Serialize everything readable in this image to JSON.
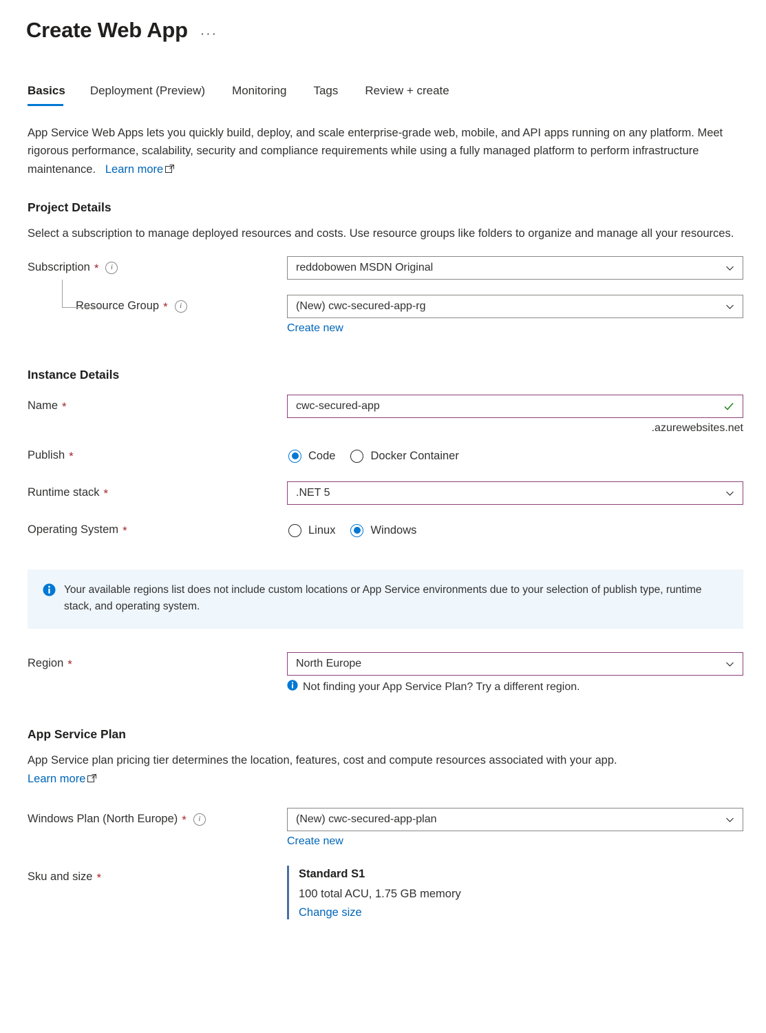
{
  "header": {
    "title": "Create Web App",
    "more_label": "···"
  },
  "tabs": [
    {
      "label": "Basics",
      "active": true
    },
    {
      "label": "Deployment (Preview)",
      "active": false
    },
    {
      "label": "Monitoring",
      "active": false
    },
    {
      "label": "Tags",
      "active": false
    },
    {
      "label": "Review + create",
      "active": false
    }
  ],
  "intro": {
    "text": "App Service Web Apps lets you quickly build, deploy, and scale enterprise-grade web, mobile, and API apps running on any platform. Meet rigorous performance, scalability, security and compliance requirements while using a fully managed platform to perform infrastructure maintenance.",
    "learn_more": "Learn more"
  },
  "project_details": {
    "heading": "Project Details",
    "description": "Select a subscription to manage deployed resources and costs. Use resource groups like folders to organize and manage all your resources.",
    "subscription": {
      "label": "Subscription",
      "required": "*",
      "value": "reddobowen MSDN Original"
    },
    "resource_group": {
      "label": "Resource Group",
      "required": "*",
      "value": "(New) cwc-secured-app-rg",
      "create_new": "Create new"
    }
  },
  "instance_details": {
    "heading": "Instance Details",
    "name": {
      "label": "Name",
      "required": "*",
      "value": "cwc-secured-app",
      "suffix": ".azurewebsites.net"
    },
    "publish": {
      "label": "Publish",
      "required": "*",
      "options": [
        {
          "label": "Code",
          "selected": true
        },
        {
          "label": "Docker Container",
          "selected": false
        }
      ]
    },
    "runtime_stack": {
      "label": "Runtime stack",
      "required": "*",
      "value": ".NET 5"
    },
    "operating_system": {
      "label": "Operating System",
      "required": "*",
      "options": [
        {
          "label": "Linux",
          "selected": false
        },
        {
          "label": "Windows",
          "selected": true
        }
      ]
    }
  },
  "banner": {
    "text": "Your available regions list does not include custom locations or App Service environments due to your selection of publish type, runtime stack, and operating system."
  },
  "region": {
    "label": "Region",
    "required": "*",
    "value": "North Europe",
    "hint": "Not finding your App Service Plan? Try a different region."
  },
  "app_service_plan": {
    "heading": "App Service Plan",
    "description": "App Service plan pricing tier determines the location, features, cost and compute resources associated with your app.",
    "learn_more": "Learn more",
    "windows_plan": {
      "label": "Windows Plan (North Europe)",
      "required": "*",
      "value": "(New) cwc-secured-app-plan",
      "create_new": "Create new"
    },
    "sku": {
      "label": "Sku and size",
      "required": "*",
      "title": "Standard S1",
      "details": "100 total ACU, 1.75 GB memory",
      "change_link": "Change size"
    }
  },
  "colors": {
    "accent_blue": "#0078d4",
    "link_blue": "#0066b8",
    "required_red": "#a4262c",
    "field_accent_purple": "#8c3f7b",
    "banner_bg": "#eff6fc",
    "success_green": "#107c10",
    "sku_bar": "#4a6fa5"
  }
}
